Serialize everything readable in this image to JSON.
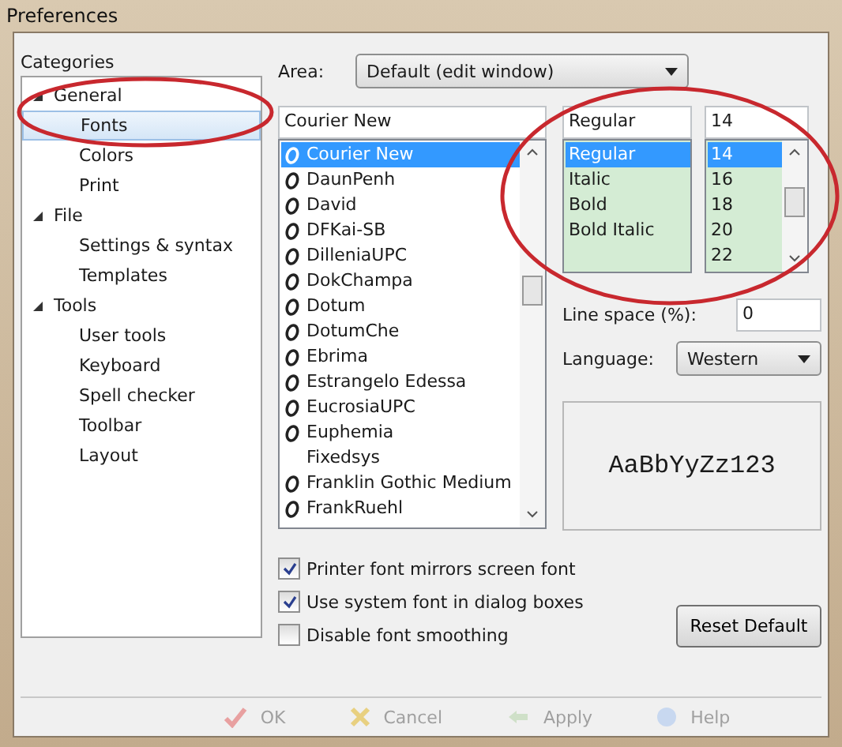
{
  "window": {
    "title": "Preferences"
  },
  "categories": {
    "label": "Categories",
    "tree": [
      {
        "label": "General",
        "expanded": true,
        "selected": false,
        "children": [
          {
            "label": "Fonts",
            "selected": true
          },
          {
            "label": "Colors",
            "selected": false
          },
          {
            "label": "Print",
            "selected": false
          }
        ]
      },
      {
        "label": "File",
        "expanded": true,
        "selected": false,
        "children": [
          {
            "label": "Settings & syntax",
            "selected": false
          },
          {
            "label": "Templates",
            "selected": false
          }
        ]
      },
      {
        "label": "Tools",
        "expanded": true,
        "selected": false,
        "children": [
          {
            "label": "User tools",
            "selected": false
          },
          {
            "label": "Keyboard",
            "selected": false
          },
          {
            "label": "Spell checker",
            "selected": false
          },
          {
            "label": "Toolbar",
            "selected": false
          },
          {
            "label": "Layout",
            "selected": false
          }
        ]
      }
    ]
  },
  "area": {
    "label": "Area:",
    "value": "Default (edit window)"
  },
  "font": {
    "value": "Courier New",
    "list": [
      {
        "label": "Courier New",
        "kind": "opentype",
        "selected": true
      },
      {
        "label": "DaunPenh",
        "kind": "opentype",
        "selected": false
      },
      {
        "label": "David",
        "kind": "opentype",
        "selected": false
      },
      {
        "label": "DFKai-SB",
        "kind": "opentype",
        "selected": false
      },
      {
        "label": "DilleniaUPC",
        "kind": "opentype",
        "selected": false
      },
      {
        "label": "DokChampa",
        "kind": "opentype",
        "selected": false
      },
      {
        "label": "Dotum",
        "kind": "opentype",
        "selected": false
      },
      {
        "label": "DotumChe",
        "kind": "opentype",
        "selected": false
      },
      {
        "label": "Ebrima",
        "kind": "opentype",
        "selected": false
      },
      {
        "label": "Estrangelo Edessa",
        "kind": "opentype",
        "selected": false
      },
      {
        "label": "EucrosiaUPC",
        "kind": "opentype",
        "selected": false
      },
      {
        "label": "Euphemia",
        "kind": "opentype",
        "selected": false
      },
      {
        "label": "Fixedsys",
        "kind": "raster",
        "selected": false
      },
      {
        "label": "Franklin Gothic Medium",
        "kind": "opentype",
        "selected": false
      },
      {
        "label": "FrankRuehl",
        "kind": "opentype",
        "selected": false
      }
    ]
  },
  "style": {
    "value": "Regular",
    "list": [
      {
        "label": "Regular",
        "selected": true
      },
      {
        "label": "Italic",
        "selected": false
      },
      {
        "label": "Bold",
        "selected": false
      },
      {
        "label": "Bold Italic",
        "selected": false
      }
    ]
  },
  "size": {
    "value": "14",
    "list": [
      {
        "label": "14",
        "selected": true
      },
      {
        "label": "16",
        "selected": false
      },
      {
        "label": "18",
        "selected": false
      },
      {
        "label": "20",
        "selected": false
      },
      {
        "label": "22",
        "selected": false
      }
    ]
  },
  "line_space": {
    "label": "Line space (%):",
    "value": "0"
  },
  "language": {
    "label": "Language:",
    "value": "Western"
  },
  "preview": {
    "text": "AaBbYyZz123"
  },
  "options": [
    {
      "label": "Printer font mirrors screen font",
      "checked": true
    },
    {
      "label": "Use system font in dialog boxes",
      "checked": true
    },
    {
      "label": "Disable font smoothing",
      "checked": false
    }
  ],
  "reset_button": {
    "label": "Reset Default"
  },
  "footer_buttons": [
    {
      "label": "OK",
      "kind": "ok",
      "disabled": true
    },
    {
      "label": "Cancel",
      "kind": "cancel",
      "disabled": true
    },
    {
      "label": "Apply",
      "kind": "apply",
      "disabled": true
    },
    {
      "label": "Help",
      "kind": "help",
      "disabled": true
    }
  ]
}
